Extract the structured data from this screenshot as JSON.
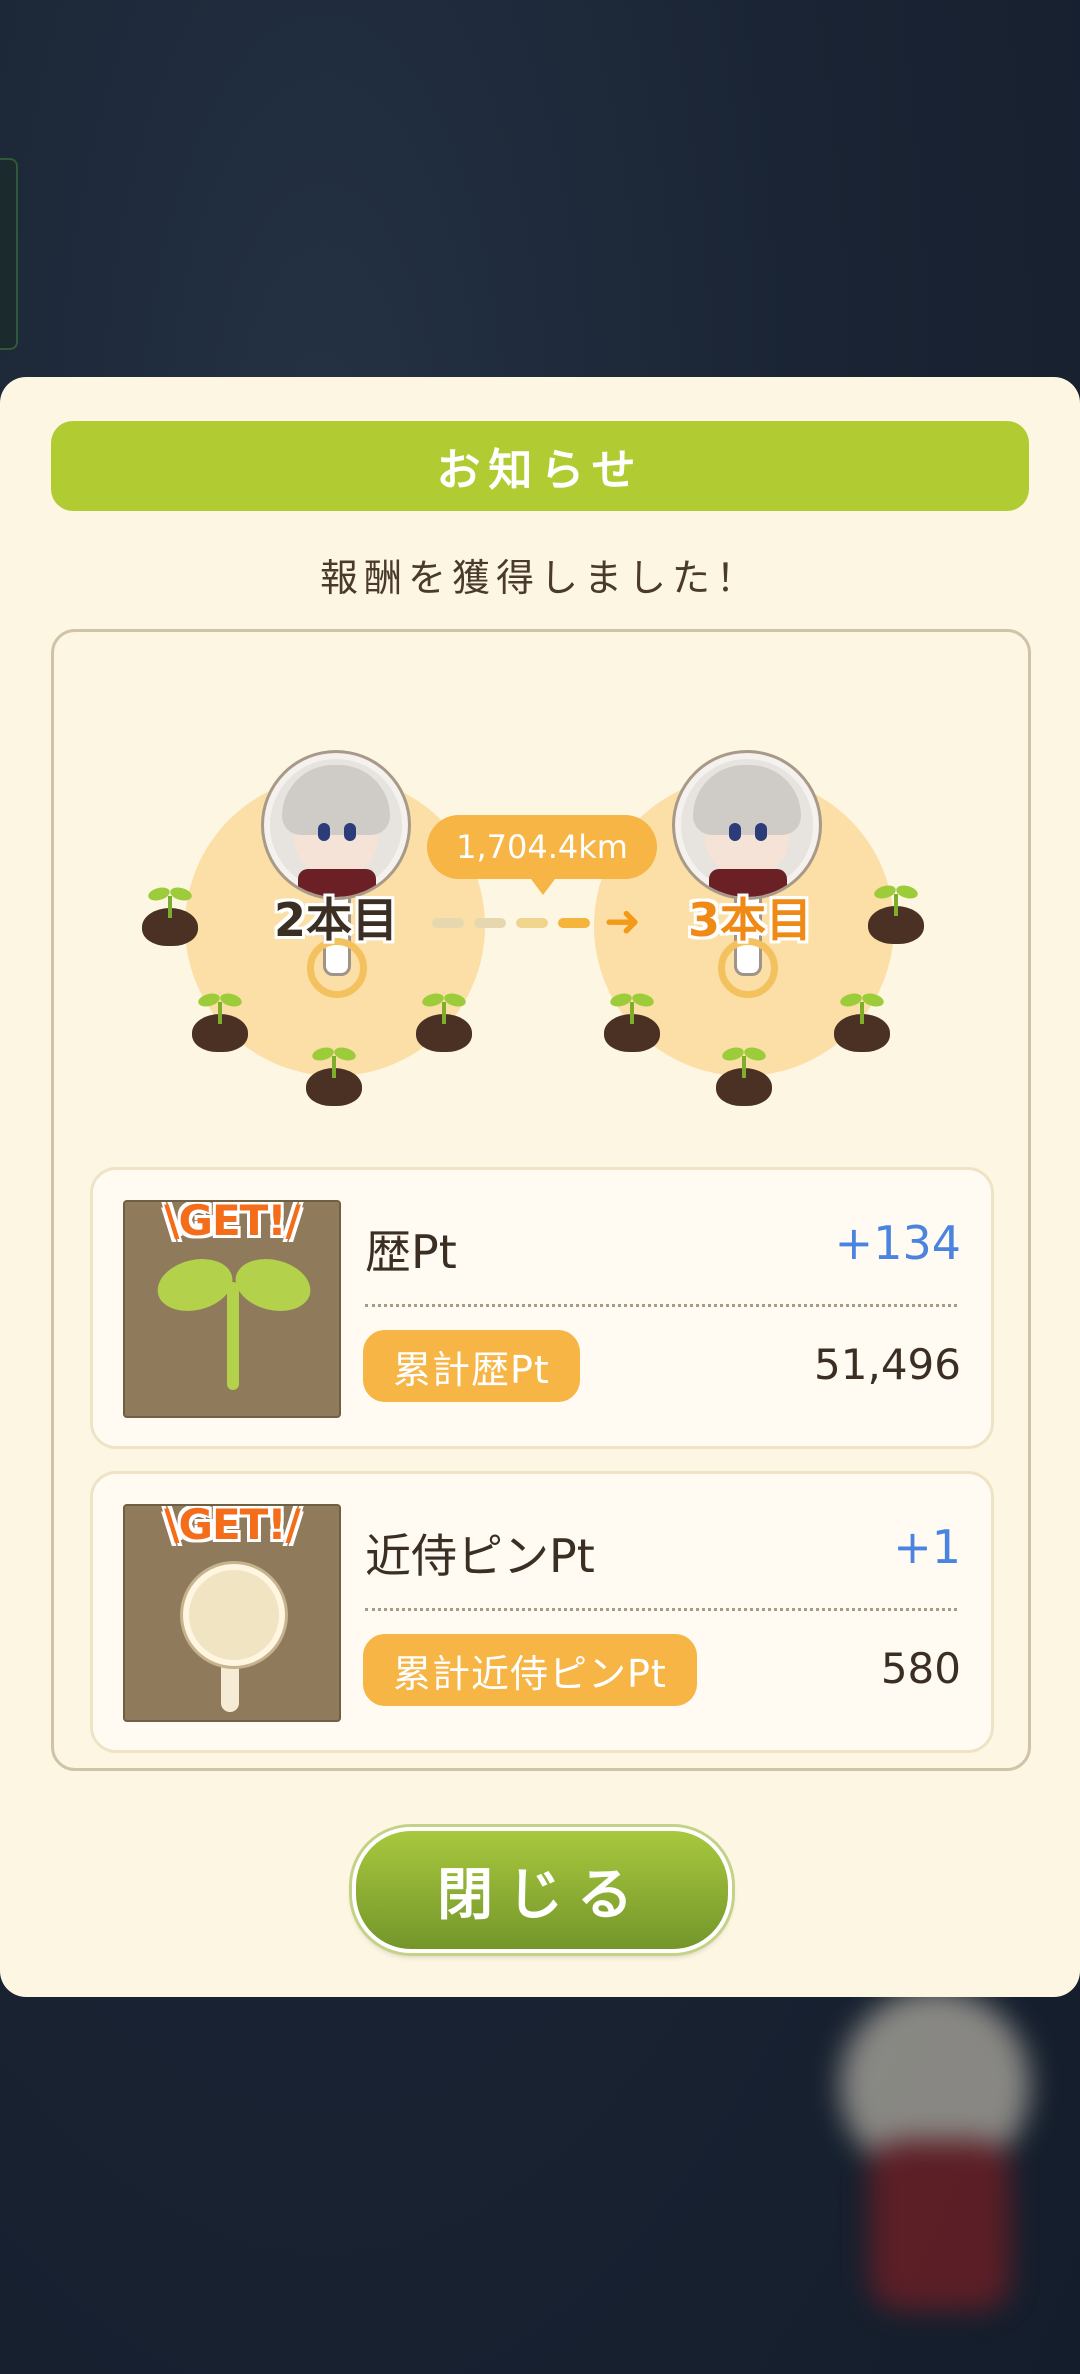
{
  "modal": {
    "title": "お知らせ",
    "message": "報酬を獲得しました！",
    "progress": {
      "from_label": "2本目",
      "to_label": "3本目",
      "distance": "1,704.4km"
    },
    "rewards": [
      {
        "icon": "sprout-icon",
        "badge": "\\GET!/",
        "name": "歴Pt",
        "gain": "+134",
        "total_label": "累計歴Pt",
        "total_value": "51,496"
      },
      {
        "icon": "magnifier-pin-icon",
        "badge": "\\GET!/",
        "name": "近侍ピンPt",
        "gain": "+1",
        "total_label": "累計近侍ピンPt",
        "total_value": "580"
      }
    ],
    "close_label": "閉じる"
  },
  "colors": {
    "header": "#b1cc32",
    "accent_orange": "#f6b545",
    "gain_blue": "#4a84e0",
    "modal_bg": "#fdf6e3"
  }
}
